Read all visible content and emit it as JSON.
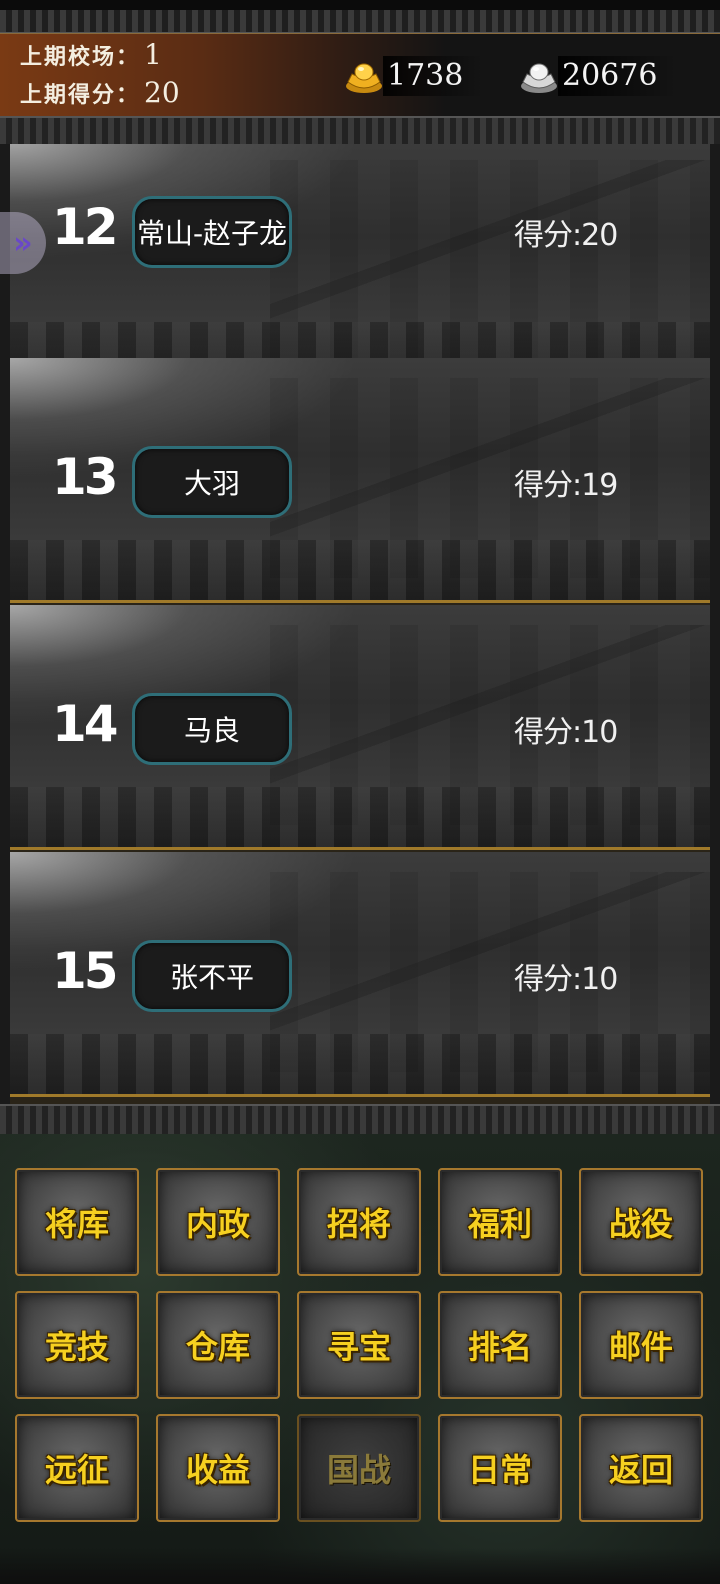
{
  "header": {
    "last_arena_label": "上期校场",
    "last_arena_value": "1",
    "last_score_label": "上期得分",
    "last_score_value": "20",
    "separator": "：",
    "gold": {
      "icon": "gold-ingot-icon",
      "amount": "1738"
    },
    "silver": {
      "icon": "silver-ingot-icon",
      "amount": "20676"
    }
  },
  "side_tab": {
    "icon": "double-chevron-right-icon",
    "glyph": "»"
  },
  "rankings": [
    {
      "rank": "12",
      "name": "常山-赵子龙",
      "score": "得分:20"
    },
    {
      "rank": "13",
      "name": "大羽",
      "score": "得分:19"
    },
    {
      "rank": "14",
      "name": "马良",
      "score": "得分:10"
    },
    {
      "rank": "15",
      "name": "张不平",
      "score": "得分:10"
    }
  ],
  "menu": {
    "row1": [
      "将库",
      "内政",
      "招将",
      "福利",
      "战役"
    ],
    "row2": [
      "竞技",
      "仓库",
      "寻宝",
      "排名",
      "邮件"
    ],
    "row3": [
      "远征",
      "收益",
      "国战",
      "日常",
      "返回"
    ]
  },
  "colors": {
    "menu_text": "#f6d020",
    "menu_border": "#a6782e",
    "pill_border": "#2e6e78",
    "row_divider": "#a07a2a",
    "header_brown": "#7a3a14"
  }
}
